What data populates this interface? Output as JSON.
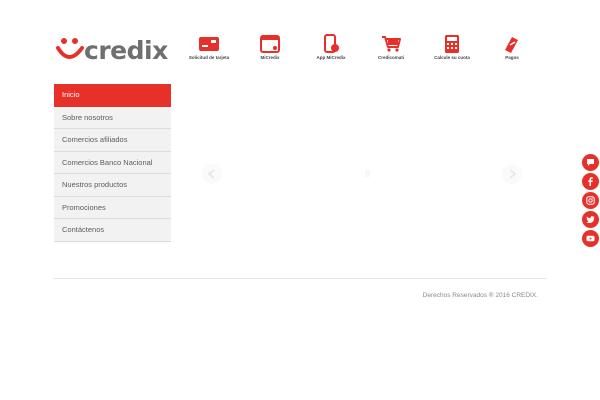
{
  "brand": {
    "logo_text": "credix",
    "accent_color": "#e8302a",
    "logo_text_color": "#6f6f6f"
  },
  "top_nav": {
    "items": [
      {
        "label": "Solicitud de tarjeta",
        "icon": "credit-card-icon"
      },
      {
        "label": "MiCredix",
        "icon": "browser-window-icon"
      },
      {
        "label": "App MiCredix",
        "icon": "mobile-app-icon"
      },
      {
        "label": "Credicomati",
        "icon": "shopping-cart-icon"
      },
      {
        "label": "Calcule su cuota",
        "icon": "calculator-icon"
      },
      {
        "label": "Pagos",
        "icon": "payment-hand-icon"
      }
    ]
  },
  "side_menu": {
    "items": [
      {
        "label": "Inicio",
        "active": true
      },
      {
        "label": "Sobre nosotros",
        "active": false
      },
      {
        "label": "Comercios afiliados",
        "active": false
      },
      {
        "label": "Comercios Banco Nacional",
        "active": false
      },
      {
        "label": "Nuestros productos",
        "active": false
      },
      {
        "label": "Promociones",
        "active": false
      },
      {
        "label": "Contáctenos",
        "active": false
      }
    ]
  },
  "slider": {
    "prev_icon": "arrow-left-icon",
    "next_icon": "arrow-right-icon"
  },
  "footer": {
    "copyright": "Derechos Reservados ® 2016 CREDIX."
  },
  "social": {
    "items": [
      {
        "icon": "chat-icon"
      },
      {
        "icon": "facebook-icon"
      },
      {
        "icon": "instagram-icon"
      },
      {
        "icon": "twitter-icon"
      },
      {
        "icon": "youtube-icon"
      }
    ]
  }
}
